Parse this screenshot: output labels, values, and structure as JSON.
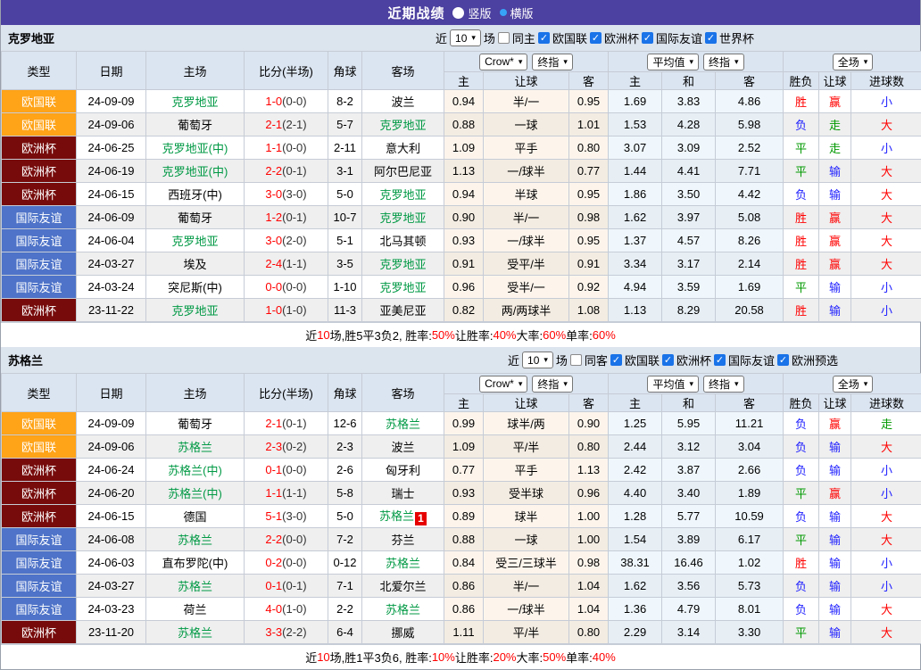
{
  "title_bar": {
    "title": "近期战绩",
    "radio_vertical": "竖版",
    "radio_horizontal": "横版",
    "selected": "横版"
  },
  "colors": {
    "header_purple": "#4c40a0",
    "type_nations": "#ffa318",
    "type_euro": "#770b0b",
    "type_friendly": "#4e73c8",
    "team_highlight": "#009944",
    "score_red": "#ff0000",
    "result_red": "#ff0000",
    "result_blue": "#2222ff",
    "result_green": "#009900",
    "checkbox_blue": "#1a73e8",
    "radio_ring_blue": "#36a3f7"
  },
  "table_headers": {
    "type": "类型",
    "date": "日期",
    "home": "主场",
    "score_half": "比分(半场)",
    "corner": "角球",
    "away": "客场",
    "sel_crow": "Crow*",
    "sel_final1": "终指",
    "sel_avg": "平均值",
    "sel_final2": "终指",
    "sel_fullmatch": "全场",
    "sub": [
      "主",
      "让球",
      "客",
      "主",
      "和",
      "客",
      "胜负",
      "让球",
      "进球数"
    ]
  },
  "sections": [
    {
      "team": "克罗地亚",
      "filter": {
        "prefix": "近",
        "count": "10",
        "suffix": "场",
        "venue_label": "同主",
        "venue_checked": false,
        "competitions": [
          {
            "label": "欧国联",
            "checked": true
          },
          {
            "label": "欧洲杯",
            "checked": true
          },
          {
            "label": "国际友谊",
            "checked": true
          },
          {
            "label": "世界杯",
            "checked": true
          }
        ]
      },
      "rows": [
        {
          "type": "欧国联",
          "type_key": "nations",
          "date": "24-09-09",
          "home": "克罗地亚",
          "home_hl": true,
          "score": "1-0",
          "half": "(0-0)",
          "corner": "8-2",
          "away": "波兰",
          "away_hl": false,
          "crow": [
            "0.94",
            "半/一",
            "0.95"
          ],
          "avg": [
            "1.69",
            "3.83",
            "4.86"
          ],
          "res": [
            [
              "胜",
              "r"
            ],
            [
              "赢",
              "r"
            ],
            [
              "小",
              "b"
            ]
          ]
        },
        {
          "type": "欧国联",
          "type_key": "nations",
          "date": "24-09-06",
          "home": "葡萄牙",
          "home_hl": false,
          "score": "2-1",
          "half": "(2-1)",
          "corner": "5-7",
          "away": "克罗地亚",
          "away_hl": true,
          "crow": [
            "0.88",
            "一球",
            "1.01"
          ],
          "avg": [
            "1.53",
            "4.28",
            "5.98"
          ],
          "res": [
            [
              "负",
              "b"
            ],
            [
              "走",
              "g"
            ],
            [
              "大",
              "r"
            ]
          ]
        },
        {
          "type": "欧洲杯",
          "type_key": "euro",
          "date": "24-06-25",
          "home": "克罗地亚(中)",
          "home_hl": true,
          "score": "1-1",
          "half": "(0-0)",
          "corner": "2-11",
          "away": "意大利",
          "away_hl": false,
          "crow": [
            "1.09",
            "平手",
            "0.80"
          ],
          "avg": [
            "3.07",
            "3.09",
            "2.52"
          ],
          "res": [
            [
              "平",
              "g"
            ],
            [
              "走",
              "g"
            ],
            [
              "小",
              "b"
            ]
          ]
        },
        {
          "type": "欧洲杯",
          "type_key": "euro",
          "date": "24-06-19",
          "home": "克罗地亚(中)",
          "home_hl": true,
          "score": "2-2",
          "half": "(0-1)",
          "corner": "3-1",
          "away": "阿尔巴尼亚",
          "away_hl": false,
          "crow": [
            "1.13",
            "一/球半",
            "0.77"
          ],
          "avg": [
            "1.44",
            "4.41",
            "7.71"
          ],
          "res": [
            [
              "平",
              "g"
            ],
            [
              "输",
              "b"
            ],
            [
              "大",
              "r"
            ]
          ]
        },
        {
          "type": "欧洲杯",
          "type_key": "euro",
          "date": "24-06-15",
          "home": "西班牙(中)",
          "home_hl": false,
          "score": "3-0",
          "half": "(3-0)",
          "corner": "5-0",
          "away": "克罗地亚",
          "away_hl": true,
          "crow": [
            "0.94",
            "半球",
            "0.95"
          ],
          "avg": [
            "1.86",
            "3.50",
            "4.42"
          ],
          "res": [
            [
              "负",
              "b"
            ],
            [
              "输",
              "b"
            ],
            [
              "大",
              "r"
            ]
          ]
        },
        {
          "type": "国际友谊",
          "type_key": "friendly",
          "date": "24-06-09",
          "home": "葡萄牙",
          "home_hl": false,
          "score": "1-2",
          "half": "(0-1)",
          "corner": "10-7",
          "away": "克罗地亚",
          "away_hl": true,
          "crow": [
            "0.90",
            "半/一",
            "0.98"
          ],
          "avg": [
            "1.62",
            "3.97",
            "5.08"
          ],
          "res": [
            [
              "胜",
              "r"
            ],
            [
              "赢",
              "r"
            ],
            [
              "大",
              "r"
            ]
          ]
        },
        {
          "type": "国际友谊",
          "type_key": "friendly",
          "date": "24-06-04",
          "home": "克罗地亚",
          "home_hl": true,
          "score": "3-0",
          "half": "(2-0)",
          "corner": "5-1",
          "away": "北马其顿",
          "away_hl": false,
          "crow": [
            "0.93",
            "一/球半",
            "0.95"
          ],
          "avg": [
            "1.37",
            "4.57",
            "8.26"
          ],
          "res": [
            [
              "胜",
              "r"
            ],
            [
              "赢",
              "r"
            ],
            [
              "大",
              "r"
            ]
          ]
        },
        {
          "type": "国际友谊",
          "type_key": "friendly",
          "date": "24-03-27",
          "home": "埃及",
          "home_hl": false,
          "score": "2-4",
          "half": "(1-1)",
          "corner": "3-5",
          "away": "克罗地亚",
          "away_hl": true,
          "crow": [
            "0.91",
            "受平/半",
            "0.91"
          ],
          "avg": [
            "3.34",
            "3.17",
            "2.14"
          ],
          "res": [
            [
              "胜",
              "r"
            ],
            [
              "赢",
              "r"
            ],
            [
              "大",
              "r"
            ]
          ]
        },
        {
          "type": "国际友谊",
          "type_key": "friendly",
          "date": "24-03-24",
          "home": "突尼斯(中)",
          "home_hl": false,
          "score": "0-0",
          "half": "(0-0)",
          "corner": "1-10",
          "away": "克罗地亚",
          "away_hl": true,
          "crow": [
            "0.96",
            "受半/一",
            "0.92"
          ],
          "avg": [
            "4.94",
            "3.59",
            "1.69"
          ],
          "res": [
            [
              "平",
              "g"
            ],
            [
              "输",
              "b"
            ],
            [
              "小",
              "b"
            ]
          ]
        },
        {
          "type": "欧洲杯",
          "type_key": "euro",
          "date": "23-11-22",
          "home": "克罗地亚",
          "home_hl": true,
          "score": "1-0",
          "half": "(1-0)",
          "corner": "11-3",
          "away": "亚美尼亚",
          "away_hl": false,
          "crow": [
            "0.82",
            "两/两球半",
            "1.08"
          ],
          "avg": [
            "1.13",
            "8.29",
            "20.58"
          ],
          "res": [
            [
              "胜",
              "r"
            ],
            [
              "输",
              "b"
            ],
            [
              "小",
              "b"
            ]
          ]
        }
      ],
      "summary": [
        [
          "近",
          "k"
        ],
        [
          "10",
          "r"
        ],
        [
          "场,胜5平3负2, 胜率:",
          "k"
        ],
        [
          "50%",
          "r"
        ],
        [
          " 让胜率:",
          "k"
        ],
        [
          "40%",
          "r"
        ],
        [
          " 大率:",
          "k"
        ],
        [
          "60%",
          "r"
        ],
        [
          " 单率:",
          "k"
        ],
        [
          "60%",
          "r"
        ]
      ]
    },
    {
      "team": "苏格兰",
      "filter": {
        "prefix": "近",
        "count": "10",
        "suffix": "场",
        "venue_label": "同客",
        "venue_checked": false,
        "competitions": [
          {
            "label": "欧国联",
            "checked": true
          },
          {
            "label": "欧洲杯",
            "checked": true
          },
          {
            "label": "国际友谊",
            "checked": true
          },
          {
            "label": "欧洲预选",
            "checked": true
          }
        ]
      },
      "rows": [
        {
          "type": "欧国联",
          "type_key": "nations",
          "date": "24-09-09",
          "home": "葡萄牙",
          "home_hl": false,
          "score": "2-1",
          "half": "(0-1)",
          "corner": "12-6",
          "away": "苏格兰",
          "away_hl": true,
          "crow": [
            "0.99",
            "球半/两",
            "0.90"
          ],
          "avg": [
            "1.25",
            "5.95",
            "11.21"
          ],
          "res": [
            [
              "负",
              "b"
            ],
            [
              "赢",
              "r"
            ],
            [
              "走",
              "g"
            ]
          ]
        },
        {
          "type": "欧国联",
          "type_key": "nations",
          "date": "24-09-06",
          "home": "苏格兰",
          "home_hl": true,
          "score": "2-3",
          "half": "(0-2)",
          "corner": "2-3",
          "away": "波兰",
          "away_hl": false,
          "crow": [
            "1.09",
            "平/半",
            "0.80"
          ],
          "avg": [
            "2.44",
            "3.12",
            "3.04"
          ],
          "res": [
            [
              "负",
              "b"
            ],
            [
              "输",
              "b"
            ],
            [
              "大",
              "r"
            ]
          ]
        },
        {
          "type": "欧洲杯",
          "type_key": "euro",
          "date": "24-06-24",
          "home": "苏格兰(中)",
          "home_hl": true,
          "score": "0-1",
          "half": "(0-0)",
          "corner": "2-6",
          "away": "匈牙利",
          "away_hl": false,
          "crow": [
            "0.77",
            "平手",
            "1.13"
          ],
          "avg": [
            "2.42",
            "3.87",
            "2.66"
          ],
          "res": [
            [
              "负",
              "b"
            ],
            [
              "输",
              "b"
            ],
            [
              "小",
              "b"
            ]
          ]
        },
        {
          "type": "欧洲杯",
          "type_key": "euro",
          "date": "24-06-20",
          "home": "苏格兰(中)",
          "home_hl": true,
          "score": "1-1",
          "half": "(1-1)",
          "corner": "5-8",
          "away": "瑞士",
          "away_hl": false,
          "crow": [
            "0.93",
            "受半球",
            "0.96"
          ],
          "avg": [
            "4.40",
            "3.40",
            "1.89"
          ],
          "res": [
            [
              "平",
              "g"
            ],
            [
              "赢",
              "r"
            ],
            [
              "小",
              "b"
            ]
          ]
        },
        {
          "type": "欧洲杯",
          "type_key": "euro",
          "date": "24-06-15",
          "home": "德国",
          "home_hl": false,
          "score": "5-1",
          "half": "(3-0)",
          "corner": "5-0",
          "away": "苏格兰",
          "away_hl": true,
          "away_badge": "1",
          "crow": [
            "0.89",
            "球半",
            "1.00"
          ],
          "avg": [
            "1.28",
            "5.77",
            "10.59"
          ],
          "res": [
            [
              "负",
              "b"
            ],
            [
              "输",
              "b"
            ],
            [
              "大",
              "r"
            ]
          ]
        },
        {
          "type": "国际友谊",
          "type_key": "friendly",
          "date": "24-06-08",
          "home": "苏格兰",
          "home_hl": true,
          "score": "2-2",
          "half": "(0-0)",
          "corner": "7-2",
          "away": "芬兰",
          "away_hl": false,
          "crow": [
            "0.88",
            "一球",
            "1.00"
          ],
          "avg": [
            "1.54",
            "3.89",
            "6.17"
          ],
          "res": [
            [
              "平",
              "g"
            ],
            [
              "输",
              "b"
            ],
            [
              "大",
              "r"
            ]
          ]
        },
        {
          "type": "国际友谊",
          "type_key": "friendly",
          "date": "24-06-03",
          "home": "直布罗陀(中)",
          "home_hl": false,
          "score": "0-2",
          "half": "(0-0)",
          "corner": "0-12",
          "away": "苏格兰",
          "away_hl": true,
          "crow": [
            "0.84",
            "受三/三球半",
            "0.98"
          ],
          "avg": [
            "38.31",
            "16.46",
            "1.02"
          ],
          "res": [
            [
              "胜",
              "r"
            ],
            [
              "输",
              "b"
            ],
            [
              "小",
              "b"
            ]
          ]
        },
        {
          "type": "国际友谊",
          "type_key": "friendly",
          "date": "24-03-27",
          "home": "苏格兰",
          "home_hl": true,
          "score": "0-1",
          "half": "(0-1)",
          "corner": "7-1",
          "away": "北爱尔兰",
          "away_hl": false,
          "crow": [
            "0.86",
            "半/一",
            "1.04"
          ],
          "avg": [
            "1.62",
            "3.56",
            "5.73"
          ],
          "res": [
            [
              "负",
              "b"
            ],
            [
              "输",
              "b"
            ],
            [
              "小",
              "b"
            ]
          ]
        },
        {
          "type": "国际友谊",
          "type_key": "friendly",
          "date": "24-03-23",
          "home": "荷兰",
          "home_hl": false,
          "score": "4-0",
          "half": "(1-0)",
          "corner": "2-2",
          "away": "苏格兰",
          "away_hl": true,
          "crow": [
            "0.86",
            "一/球半",
            "1.04"
          ],
          "avg": [
            "1.36",
            "4.79",
            "8.01"
          ],
          "res": [
            [
              "负",
              "b"
            ],
            [
              "输",
              "b"
            ],
            [
              "大",
              "r"
            ]
          ]
        },
        {
          "type": "欧洲杯",
          "type_key": "euro",
          "date": "23-11-20",
          "home": "苏格兰",
          "home_hl": true,
          "score": "3-3",
          "half": "(2-2)",
          "corner": "6-4",
          "away": "挪威",
          "away_hl": false,
          "crow": [
            "1.11",
            "平/半",
            "0.80"
          ],
          "avg": [
            "2.29",
            "3.14",
            "3.30"
          ],
          "res": [
            [
              "平",
              "g"
            ],
            [
              "输",
              "b"
            ],
            [
              "大",
              "r"
            ]
          ]
        }
      ],
      "summary": [
        [
          "近",
          "k"
        ],
        [
          "10",
          "r"
        ],
        [
          "场,胜1平3负6, 胜率:",
          "k"
        ],
        [
          "10%",
          "r"
        ],
        [
          " 让胜率:",
          "k"
        ],
        [
          "20%",
          "r"
        ],
        [
          " 大率:",
          "k"
        ],
        [
          "50%",
          "r"
        ],
        [
          " 单率:",
          "k"
        ],
        [
          "40%",
          "r"
        ]
      ]
    }
  ]
}
